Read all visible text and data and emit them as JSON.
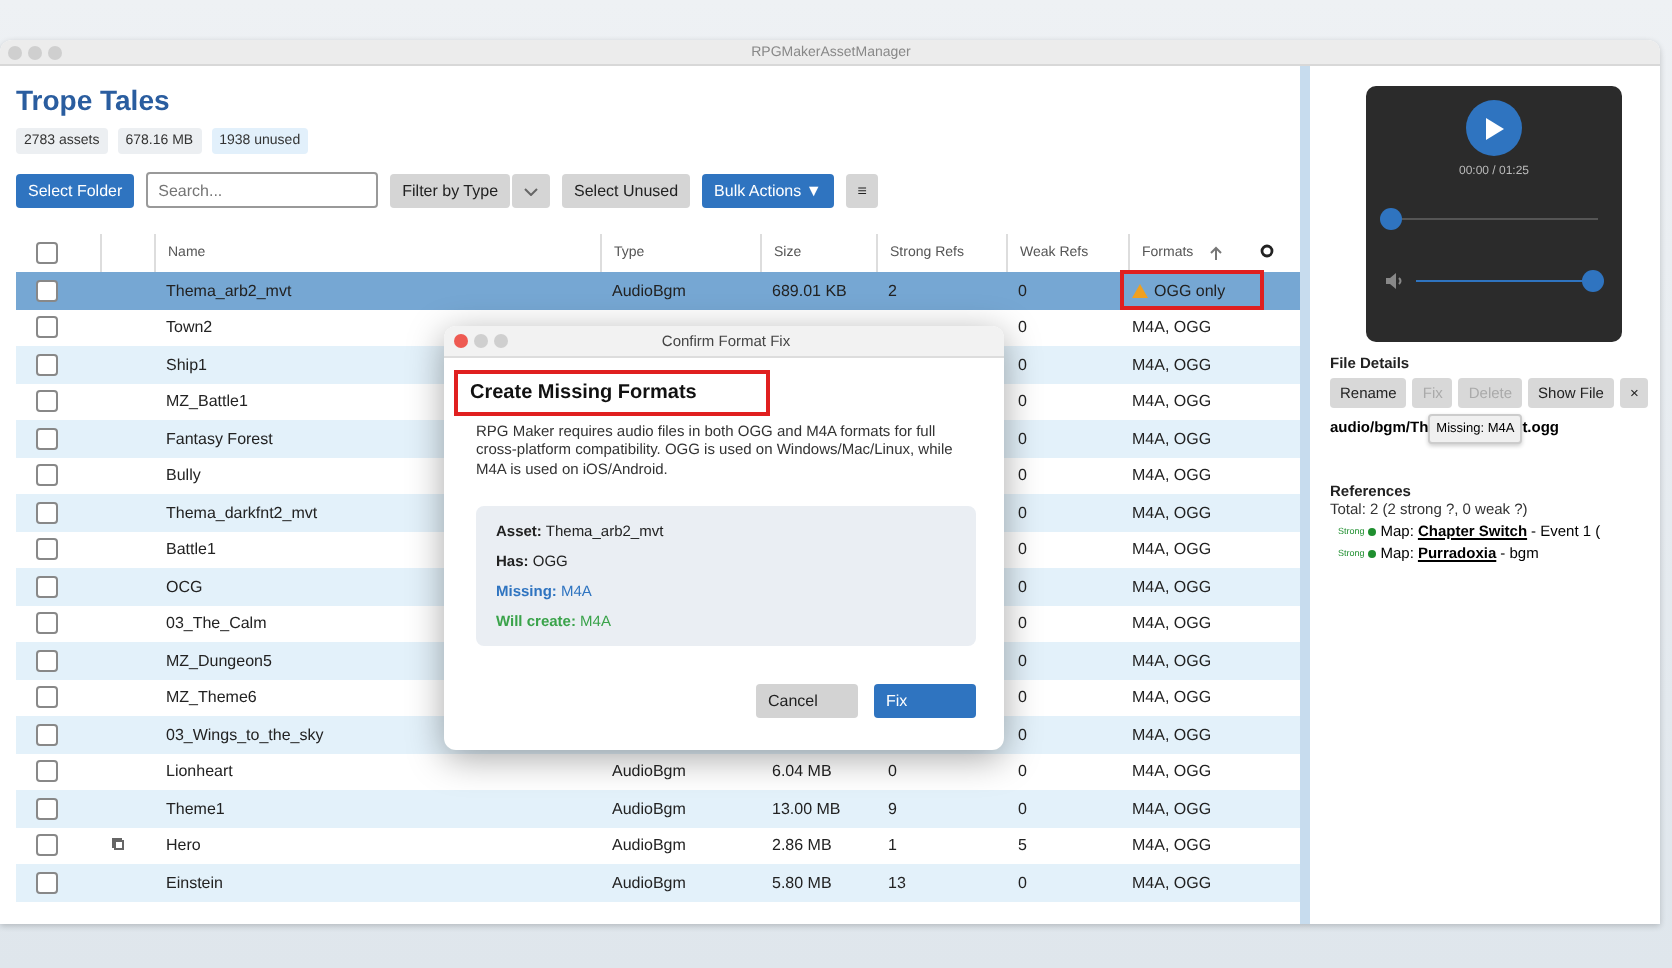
{
  "window": {
    "title": "RPGMakerAssetManager"
  },
  "project": {
    "title": "Trope Tales",
    "stats": [
      {
        "label": "2783 assets",
        "kind": "plain"
      },
      {
        "label": "678.16 MB",
        "kind": "plain"
      },
      {
        "label": "1938 unused",
        "kind": "info"
      }
    ]
  },
  "toolbar": {
    "select_folder": "Select Folder",
    "search": {
      "placeholder": "Search..."
    },
    "filter": "Filter by Type",
    "select_unused": "Select Unused",
    "bulk_actions": "Bulk Actions ▼",
    "menu": "≡"
  },
  "table": {
    "select_all_checked": false,
    "columns": [
      {
        "label": "Name",
        "sorted": false
      },
      {
        "label": "Type",
        "sorted": false
      },
      {
        "label": "Size",
        "sorted": false
      },
      {
        "label": "Strong Refs",
        "sorted": false
      },
      {
        "label": "Weak Refs",
        "sorted": false
      },
      {
        "label": "Formats",
        "sorted": true
      }
    ],
    "rows": [
      {
        "name": "Thema_arb2_mvt",
        "type": "AudioBgm",
        "size": "689.01 KB",
        "strong": "2",
        "weak": "0",
        "formats": "OGG only",
        "warning": true,
        "highlighted": true,
        "selected": true,
        "checked": false,
        "linked": false
      },
      {
        "name": "Town2",
        "weak": "0",
        "formats": "M4A, OGG",
        "warning": false,
        "highlighted": false,
        "selected": false,
        "checked": false,
        "linked": false
      },
      {
        "name": "Ship1",
        "weak": "0",
        "formats": "M4A, OGG",
        "warning": false,
        "highlighted": false,
        "selected": false,
        "checked": false,
        "linked": false
      },
      {
        "name": "MZ_Battle1",
        "weak": "0",
        "formats": "M4A, OGG",
        "warning": false,
        "highlighted": false,
        "selected": false,
        "checked": false,
        "linked": false
      },
      {
        "name": "Fantasy Forest",
        "weak": "0",
        "formats": "M4A, OGG",
        "warning": false,
        "highlighted": false,
        "selected": false,
        "checked": false,
        "linked": false
      },
      {
        "name": "Bully",
        "weak": "0",
        "formats": "M4A, OGG",
        "warning": false,
        "highlighted": false,
        "selected": false,
        "checked": false,
        "linked": false
      },
      {
        "name": "Thema_darkfnt2_mvt",
        "weak": "0",
        "formats": "M4A, OGG",
        "warning": false,
        "highlighted": false,
        "selected": false,
        "checked": false,
        "linked": false
      },
      {
        "name": "Battle1",
        "weak": "0",
        "formats": "M4A, OGG",
        "warning": false,
        "highlighted": false,
        "selected": false,
        "checked": false,
        "linked": false
      },
      {
        "name": "OCG",
        "weak": "0",
        "formats": "M4A, OGG",
        "warning": false,
        "highlighted": false,
        "selected": false,
        "checked": false,
        "linked": false
      },
      {
        "name": "03_The_Calm",
        "weak": "0",
        "formats": "M4A, OGG",
        "warning": false,
        "highlighted": false,
        "selected": false,
        "checked": false,
        "linked": false
      },
      {
        "name": "MZ_Dungeon5",
        "weak": "0",
        "formats": "M4A, OGG",
        "warning": false,
        "highlighted": false,
        "selected": false,
        "checked": false,
        "linked": false
      },
      {
        "name": "MZ_Theme6",
        "weak": "0",
        "formats": "M4A, OGG",
        "warning": false,
        "highlighted": false,
        "selected": false,
        "checked": false,
        "linked": false
      },
      {
        "name": "03_Wings_to_the_sky",
        "weak": "0",
        "formats": "M4A, OGG",
        "warning": false,
        "highlighted": false,
        "selected": false,
        "checked": false,
        "linked": false
      },
      {
        "name": "Lionheart",
        "type": "AudioBgm",
        "size": "6.04 MB",
        "strong": "0",
        "weak": "0",
        "formats": "M4A, OGG",
        "warning": false,
        "highlighted": false,
        "selected": false,
        "checked": false,
        "linked": false
      },
      {
        "name": "Theme1",
        "type": "AudioBgm",
        "size": "13.00 MB",
        "strong": "9",
        "weak": "0",
        "formats": "M4A, OGG",
        "warning": false,
        "highlighted": false,
        "selected": false,
        "checked": false,
        "linked": false
      },
      {
        "name": "Hero",
        "type": "AudioBgm",
        "size": "2.86 MB",
        "strong": "1",
        "weak": "5",
        "formats": "M4A, OGG",
        "warning": false,
        "highlighted": false,
        "selected": false,
        "checked": false,
        "linked": true
      },
      {
        "name": "Einstein",
        "type": "AudioBgm",
        "size": "5.80 MB",
        "strong": "13",
        "weak": "0",
        "formats": "M4A, OGG",
        "warning": false,
        "highlighted": false,
        "selected": false,
        "checked": false,
        "linked": false
      }
    ]
  },
  "player": {
    "time": "00:00 / 01:25",
    "progress": {
      "level": 0
    },
    "volume": {
      "level": 1,
      "muted": false
    }
  },
  "file_details": {
    "title": "File Details",
    "buttons": [
      {
        "label": "Rename",
        "disabled": false
      },
      {
        "label": "Fix",
        "disabled": true
      },
      {
        "label": "Delete",
        "disabled": true
      },
      {
        "label": "Show File",
        "disabled": false
      },
      {
        "label": "×",
        "disabled": false
      }
    ],
    "path_start": "audio/bgm/Th",
    "path_end": "t.ogg",
    "tooltip": "Missing: M4A"
  },
  "references": {
    "title": "References",
    "total": "Total: 2 (2 strong ?, 0 weak ?)",
    "items": [
      {
        "strength": "Strong",
        "color": "#1f8f2f",
        "prefix": "Map:",
        "link": "Chapter Switch",
        "suffix": "- Event 1 ("
      },
      {
        "strength": "Strong",
        "color": "#1f8f2f",
        "prefix": "Map:",
        "link": "Purradoxia",
        "suffix": "- bgm"
      }
    ]
  },
  "dialog": {
    "title": "Confirm Format Fix",
    "heading": "Create Missing Formats",
    "heading_highlighted": true,
    "message": "RPG Maker requires audio files in both OGG and M4A formats for full cross-platform compatibility. OGG is used on Windows/Mac/Linux, while M4A is used on iOS/Android.",
    "details": [
      {
        "label": "Asset:",
        "value": "Thema_arb2_mvt",
        "kind": "plain"
      },
      {
        "label": "Has:",
        "value": "OGG",
        "kind": "plain"
      },
      {
        "label": "Missing:",
        "value": "M4A",
        "kind": "missing"
      },
      {
        "label": "Will create:",
        "value": "M4A",
        "kind": "create"
      }
    ],
    "buttons": [
      {
        "label": "Cancel",
        "kind": "secondary"
      },
      {
        "label": "Fix",
        "kind": "primary"
      }
    ]
  }
}
